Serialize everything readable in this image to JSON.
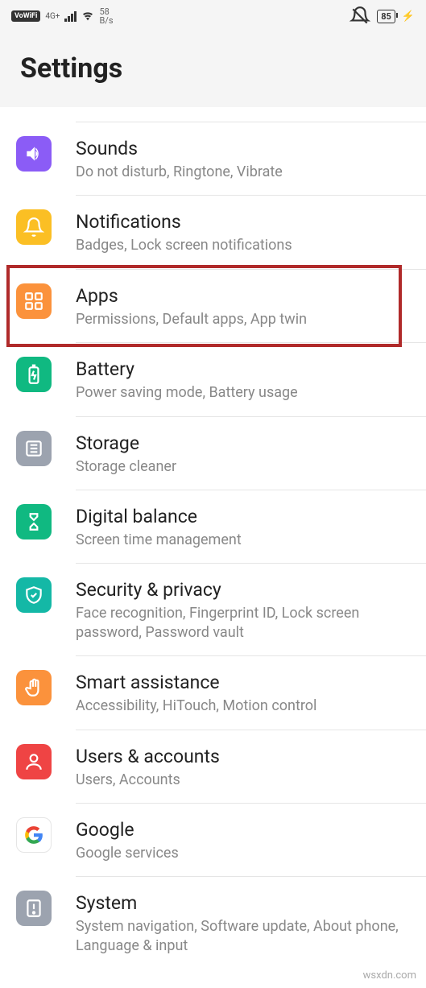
{
  "statusbar": {
    "vowifi": "VoWiFi",
    "network": "4G+",
    "speed_num": "58",
    "speed_unit": "B/s",
    "battery": "85"
  },
  "header": {
    "title": "Settings"
  },
  "items": [
    {
      "id": "sounds",
      "title": "Sounds",
      "sub": "Do not disturb, Ringtone, Vibrate",
      "color": "ic-purple"
    },
    {
      "id": "notifications",
      "title": "Notifications",
      "sub": "Badges, Lock screen notifications",
      "color": "ic-yellow"
    },
    {
      "id": "apps",
      "title": "Apps",
      "sub": "Permissions, Default apps, App twin",
      "color": "ic-orange",
      "highlighted": true
    },
    {
      "id": "battery",
      "title": "Battery",
      "sub": "Power saving mode, Battery usage",
      "color": "ic-green"
    },
    {
      "id": "storage",
      "title": "Storage",
      "sub": "Storage cleaner",
      "color": "ic-gray"
    },
    {
      "id": "digital-balance",
      "title": "Digital balance",
      "sub": "Screen time management",
      "color": "ic-green"
    },
    {
      "id": "security",
      "title": "Security & privacy",
      "sub": "Face recognition, Fingerprint ID, Lock screen password, Password vault",
      "color": "ic-teal"
    },
    {
      "id": "smart-assistance",
      "title": "Smart assistance",
      "sub": "Accessibility, HiTouch, Motion control",
      "color": "ic-orange"
    },
    {
      "id": "users",
      "title": "Users & accounts",
      "sub": "Users, Accounts",
      "color": "ic-red"
    },
    {
      "id": "google",
      "title": "Google",
      "sub": "Google services",
      "color": "ic-white"
    },
    {
      "id": "system",
      "title": "System",
      "sub": "System navigation, Software update, About phone, Language & input",
      "color": "ic-gray"
    }
  ],
  "watermark": "wsxdn.com"
}
